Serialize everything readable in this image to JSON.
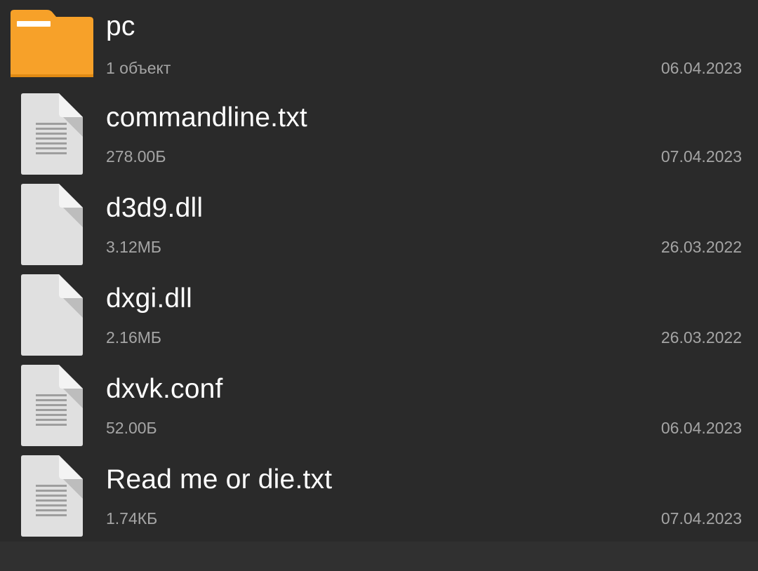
{
  "colors": {
    "background": "#2a2a2a",
    "folder": "#f7a129",
    "file": "#e0e0e0",
    "name_text": "#ffffff",
    "meta_text": "#a5a5a5"
  },
  "items": [
    {
      "icon": "folder-icon",
      "name": "pc",
      "meta": "1 объект",
      "date": "06.04.2023"
    },
    {
      "icon": "text-file-icon",
      "name": "commandline.txt",
      "meta": "278.00Б",
      "date": "07.04.2023"
    },
    {
      "icon": "blank-file-icon",
      "name": "d3d9.dll",
      "meta": "3.12МБ",
      "date": "26.03.2022"
    },
    {
      "icon": "blank-file-icon",
      "name": "dxgi.dll",
      "meta": "2.16МБ",
      "date": "26.03.2022"
    },
    {
      "icon": "text-file-icon",
      "name": "dxvk.conf",
      "meta": "52.00Б",
      "date": "06.04.2023"
    },
    {
      "icon": "text-file-icon",
      "name": "Read me or die.txt",
      "meta": "1.74КБ",
      "date": "07.04.2023"
    }
  ]
}
